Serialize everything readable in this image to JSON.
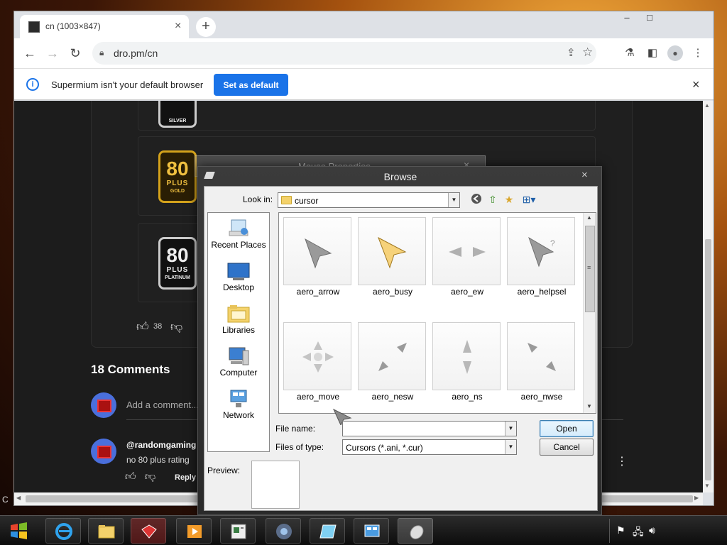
{
  "browser": {
    "tab_title": "cn (1003×847)",
    "tab_close": "×",
    "new_tab": "+",
    "window_controls": {
      "minimize": "–",
      "maximize": "□"
    },
    "url": "dro.pm/cn",
    "icons": [
      "back-arrow-icon",
      "forward-arrow-icon",
      "reload-icon",
      "lock-icon",
      "share-icon",
      "star-icon",
      "lab-flask-icon",
      "side-panel-icon",
      "profile-icon",
      "menu-kebab-icon"
    ],
    "infobar": {
      "message": "Supermium isn't your default browser",
      "button": "Set as default",
      "close": "×"
    }
  },
  "page": {
    "badges": [
      {
        "num": "",
        "plus": "",
        "level": "SILVER",
        "color": "#c0c0c0"
      },
      {
        "num": "80",
        "plus": "PLUS",
        "level": "GOLD",
        "color": "#d4a21b"
      },
      {
        "num": "80",
        "plus": "PLUS",
        "level": "PLATINUM",
        "color": "#bfc5cc"
      }
    ],
    "like_count": "38",
    "comments_title": "18 Comments",
    "add_comment_placeholder": "Add a comment...",
    "comment": {
      "author": "@randomgaming",
      "text": "no 80 plus rating",
      "reply": "Reply"
    },
    "edge_char": "C"
  },
  "ghost_dialog": {
    "title": "Mouse Properties",
    "close": "×"
  },
  "dialog": {
    "title": "Browse",
    "close": "×",
    "look_in_label": "Look in:",
    "look_in_value": "cursor",
    "places": [
      {
        "label": "Recent Places",
        "icon": "recent-places-icon"
      },
      {
        "label": "Desktop",
        "icon": "desktop-icon"
      },
      {
        "label": "Libraries",
        "icon": "libraries-icon"
      },
      {
        "label": "Computer",
        "icon": "computer-icon"
      },
      {
        "label": "Network",
        "icon": "network-icon"
      }
    ],
    "files": [
      {
        "name": "aero_arrow",
        "icon": "arrow"
      },
      {
        "name": "aero_busy",
        "icon": "busy"
      },
      {
        "name": "aero_ew",
        "icon": "ew"
      },
      {
        "name": "aero_helpsel",
        "icon": "helpsel"
      },
      {
        "name": "aero_move",
        "icon": "move"
      },
      {
        "name": "aero_nesw",
        "icon": "nesw"
      },
      {
        "name": "aero_ns",
        "icon": "ns"
      },
      {
        "name": "aero_nwse",
        "icon": "nwse"
      }
    ],
    "file_name_label": "File name:",
    "file_name_value": "",
    "files_of_type_label": "Files of type:",
    "files_of_type_value": "Cursors (*.ani, *.cur)",
    "open_button": "Open",
    "cancel_button": "Cancel",
    "preview_label": "Preview:"
  },
  "taskbar": {
    "apps": [
      "internet-explorer-icon",
      "file-explorer-icon",
      "red-app-icon",
      "media-player-icon",
      "document-viewer-icon",
      "chrome-like-browser-icon",
      "photo-app-icon",
      "control-panel-icon",
      "mouse-icon"
    ],
    "tray": [
      "flag-icon",
      "network-icon",
      "volume-icon"
    ]
  }
}
